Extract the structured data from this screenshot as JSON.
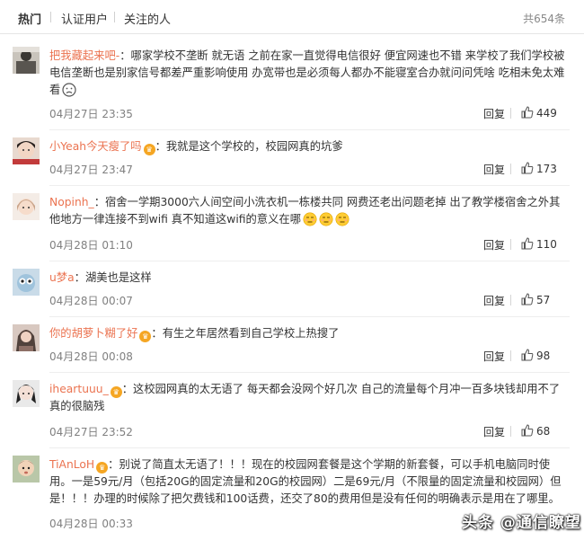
{
  "tabs": {
    "items": [
      {
        "label": "热门",
        "active": true
      },
      {
        "label": "认证用户",
        "active": false
      },
      {
        "label": "关注的人",
        "active": false
      }
    ],
    "total_count": "共654条"
  },
  "actions": {
    "reply_label": "回复"
  },
  "comments": [
    {
      "username": "把我藏起来吧-",
      "badge": false,
      "text": "：哪家学校不垄断 就无语 之前在家一直觉得电信很好 便宜网速也不错 来学校了我们学校被电信垄断也是别家信号都差严重影响使用 办宽带也是必须每人都办不能寝室合办就问问凭啥 吃相未免太难看",
      "emojis": [
        "frown"
      ],
      "time": "04月27日 23:35",
      "likes": "449"
    },
    {
      "username": "小Yeah今天瘦了吗",
      "badge": true,
      "text": "：我就是这个学校的，校园网真的坑爹",
      "emojis": [],
      "time": "04月27日 23:47",
      "likes": "173"
    },
    {
      "username": "Nopinh_",
      "badge": false,
      "text": "：宿舍一学期3000六人间空间小洗衣机一栋楼共同 网费还老出问题老掉 出了教学楼宿舍之外其他地方一律连接不到wifi 真不知道这wifi的意义在哪",
      "emojis": [
        "awkward",
        "awkward",
        "awkward"
      ],
      "time": "04月28日 01:10",
      "likes": "110"
    },
    {
      "username": "u梦a",
      "badge": false,
      "text": "：湖美也是这样",
      "emojis": [],
      "time": "04月28日 00:07",
      "likes": "57"
    },
    {
      "username": "你的胡萝卜糊了好",
      "badge": true,
      "text": "：有生之年居然看到自己学校上热搜了",
      "emojis": [],
      "time": "04月28日 00:08",
      "likes": "98"
    },
    {
      "username": "iheartuuu_",
      "badge": true,
      "text": "：这校园网真的太无语了 每天都会没网个好几次 自己的流量每个月冲一百多块钱却用不了 真的很脑残",
      "emojis": [],
      "time": "04月27日 23:52",
      "likes": "68"
    },
    {
      "username": "TiAnLoH",
      "badge": true,
      "text": "：别说了简直太无语了！！！现在的校园网套餐是这个学期的新套餐，可以手机电脑同时使用。一是59元/月（包括20G的固定流量和20G的校园网）二是69元/月（不限量的固定流量和校园网）但是！！！办理的时候除了把欠费钱和100话费，还交了80的费用但是没有任何的明确表示是用在了哪里。",
      "emojis": [],
      "time": "04月28日 00:33",
      "likes": ""
    }
  ],
  "watermark": "头条 @通信瞭望",
  "colors": {
    "username": "#eb7350",
    "timestamp": "#808080",
    "badge": "#f5a623",
    "divider": "#eeeeee"
  },
  "icons": {
    "like": "thumbs-up-icon",
    "badge": "vip-crown-icon",
    "emoji_frown": "frown-emoji-icon",
    "emoji_awkward": "awkward-emoji-icon"
  }
}
